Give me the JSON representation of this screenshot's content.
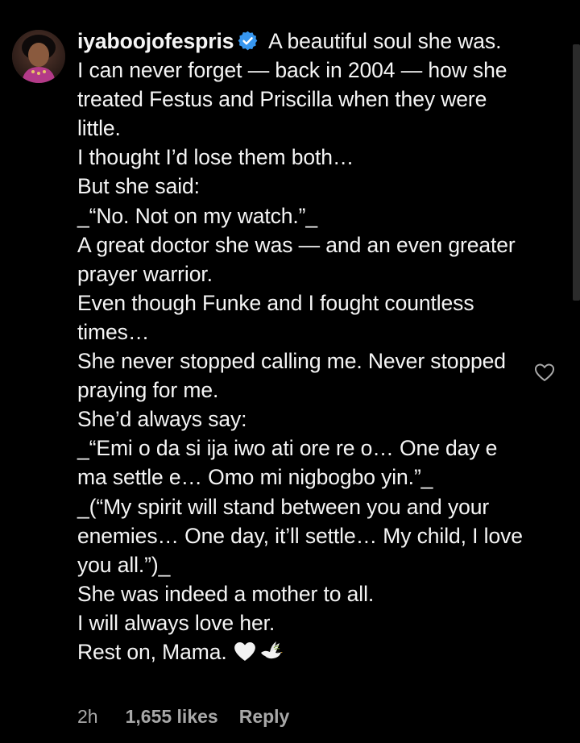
{
  "comment": {
    "username": "iyaboojofespris",
    "verified_icon": "verified-badge-icon",
    "text": " A beautiful soul she was.\nI can never forget — back in 2004 — how she treated Festus and Priscilla when they were little.\nI thought I’d lose them both…\nBut she said:\n_“No. Not on my watch.”_\nA great doctor she was — and an even greater prayer warrior.\nEven though Funke and I fought countless times…\nShe never stopped calling me. Never stopped praying for me.\nShe’d always say:\n_“Emi o da si ija iwo ati ore re o… One day e ma settle e… Omo mi nigbogbo yin.”_\n_(“My spirit will stand between you and your enemies… One day, it’ll settle… My child, I love you all.”)_\nShe was indeed a mother to all.\nI will always love her.\nRest on, Mama. ",
    "emojis": [
      "white-heart",
      "dove"
    ],
    "time": "2h",
    "likes": "1,655 likes",
    "reply_label": "Reply",
    "like_icon": "heart-outline-icon",
    "verified_color": "#3797f0"
  }
}
